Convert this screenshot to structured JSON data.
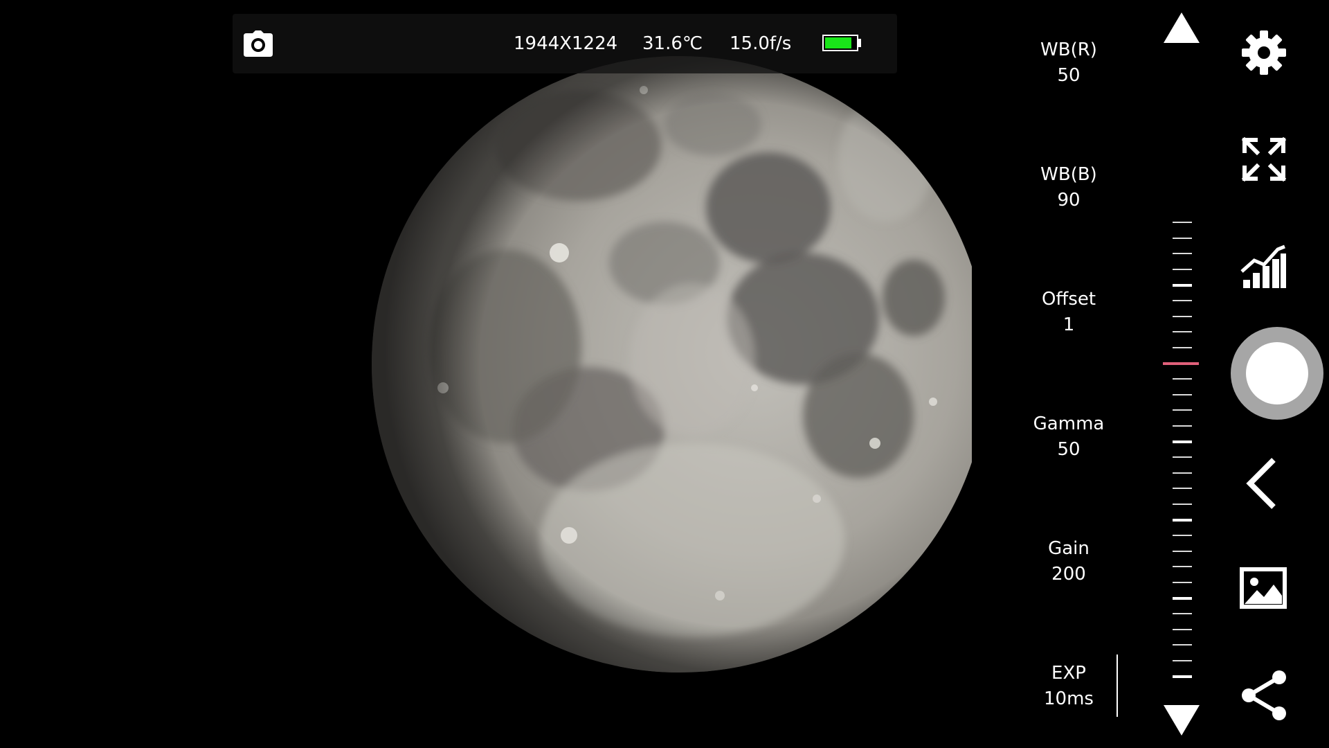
{
  "status_bar": {
    "resolution": "1944X1224",
    "temperature": "31.6℃",
    "frame_rate": "15.0f/s",
    "battery_level_fraction": 0.86,
    "battery_color": "#19e619"
  },
  "params": [
    {
      "label": "WB(R)",
      "value": "50"
    },
    {
      "label": "WB(B)",
      "value": "90"
    },
    {
      "label": "Offset",
      "value": "1"
    },
    {
      "label": "Gamma",
      "value": "50"
    },
    {
      "label": "Gain",
      "value": "200"
    },
    {
      "label": "EXP",
      "value": "10ms"
    }
  ],
  "slider": {
    "indicator_color": "#e0607a",
    "indicator_tick_index": 9,
    "tick_count": 30
  },
  "icons": {
    "camera": "camera-icon",
    "settings": "gear-icon",
    "fullscreen": "expand-icon",
    "histogram": "signal-chart-icon",
    "shutter": "shutter-icon",
    "back": "chevron-left-icon",
    "gallery": "image-icon",
    "share": "share-icon"
  }
}
